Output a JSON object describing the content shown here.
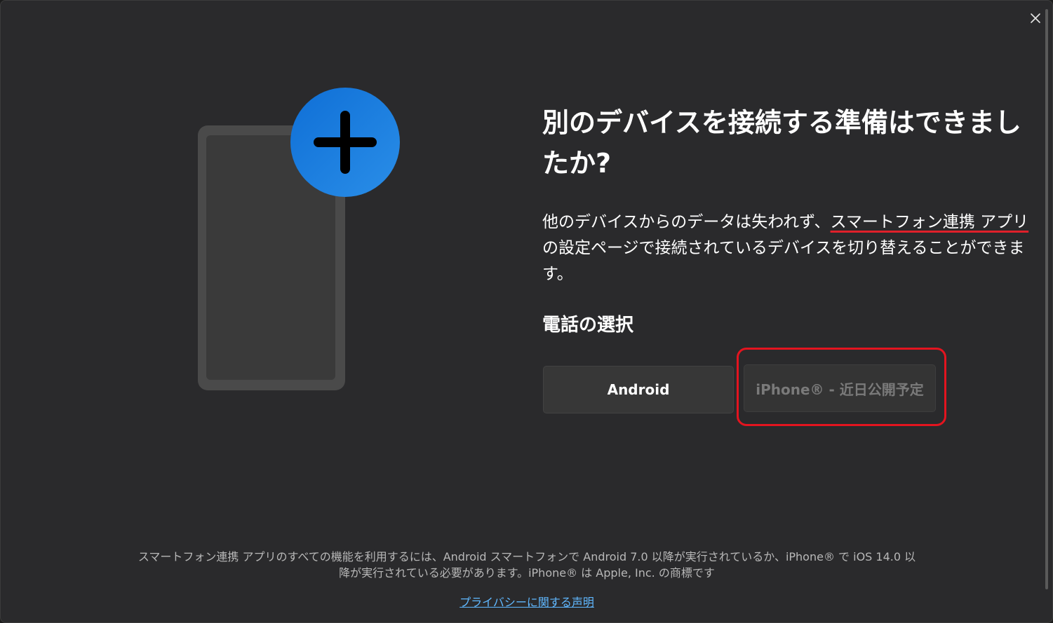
{
  "dialog": {
    "title": "別のデバイスを接続する準備はできましたか?",
    "description_part1": "他のデバイスからのデータは失われず、",
    "description_app_name": "スマートフォン連携 アプリ",
    "description_part2": "の設定ページで接続されているデバイスを切り替えることができます。",
    "phone_selection_heading": "電話の選択",
    "buttons": {
      "android": "Android",
      "iphone": "iPhone® - 近日公開予定"
    },
    "footer_note": "スマートフォン連携 アプリのすべての機能を利用するには、Android スマートフォンで Android 7.0 以降が実行されているか、iPhone® で iOS 14.0 以降が実行されている必要があります。iPhone® は Apple, Inc. の商標です",
    "privacy_link": "プライバシーに関する声明"
  },
  "icons": {
    "close": "close-icon",
    "phone_illustration": "phone-illustration",
    "plus": "plus-icon"
  },
  "colors": {
    "background": "#2a2a2c",
    "accent_blue": "#1b7be0",
    "highlight_red": "#e3141f",
    "link": "#60b8ff"
  }
}
